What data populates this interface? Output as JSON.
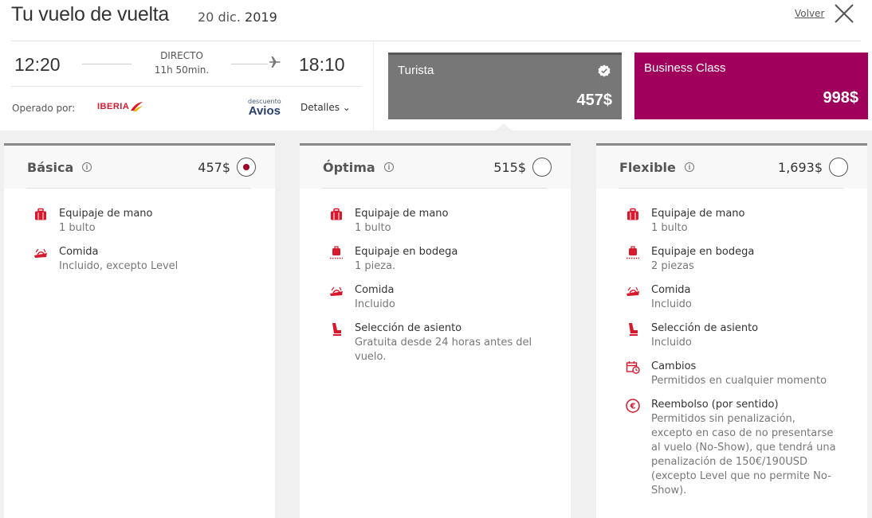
{
  "header": {
    "title": "Tu vuelo de vuelta",
    "date": "20 dic.",
    "year": "2019",
    "back_label": "Volver"
  },
  "flight": {
    "departure": "12:20",
    "arrival": "18:10",
    "type": "DIRECTO",
    "duration": "11h 50min.",
    "operated_by_label": "Operado por:",
    "airline": "IBERIA",
    "avios_small": "descuento",
    "avios_main": "Avios",
    "details_label": "Detalles ⌄"
  },
  "cabins": [
    {
      "name": "Turista",
      "price": "457$"
    },
    {
      "name": "Business Class",
      "price": "998$"
    }
  ],
  "fares": [
    {
      "name": "Básica",
      "price": "457$",
      "selected": true,
      "features": [
        {
          "icon": "hand-luggage-icon",
          "title": "Equipaje de mano",
          "desc": "1 bulto"
        },
        {
          "icon": "meal-icon",
          "title": "Comida",
          "desc": "Incluido, excepto Level"
        }
      ]
    },
    {
      "name": "Óptima",
      "price": "515$",
      "selected": false,
      "features": [
        {
          "icon": "hand-luggage-icon",
          "title": "Equipaje de mano",
          "desc": "1 bulto"
        },
        {
          "icon": "checked-luggage-icon",
          "title": "Equipaje en bodega",
          "desc": "1 pieza."
        },
        {
          "icon": "meal-icon",
          "title": "Comida",
          "desc": "Incluido"
        },
        {
          "icon": "seat-icon",
          "title": "Selección de asiento",
          "desc": [
            "Gratuita desde 24 horas antes del",
            "vuelo."
          ]
        }
      ]
    },
    {
      "name": "Flexible",
      "price": "1,693$",
      "selected": false,
      "features": [
        {
          "icon": "hand-luggage-icon",
          "title": "Equipaje de mano",
          "desc": "1 bulto"
        },
        {
          "icon": "checked-luggage-icon",
          "title": "Equipaje en bodega",
          "desc": "2 piezas"
        },
        {
          "icon": "meal-icon",
          "title": "Comida",
          "desc": "Incluido"
        },
        {
          "icon": "seat-icon",
          "title": "Selección de asiento",
          "desc": "Incluido"
        },
        {
          "icon": "calendar-change-icon",
          "title": "Cambios",
          "desc": "Permitidos en cualquier momento"
        },
        {
          "icon": "refund-euro-icon",
          "title": "Reembolso (por sentido)",
          "desc": [
            "Permitidos sin penalización,",
            "excepto en caso de no presentarse",
            "al vuelo (No-Show), que tendrá una",
            "penalización de 150€/190USD",
            "(excepto Level que no permite No-",
            "Show)."
          ]
        }
      ]
    }
  ],
  "colors": {
    "accent": "#d7192d",
    "business": "#a0005c",
    "tourist": "#777777"
  }
}
